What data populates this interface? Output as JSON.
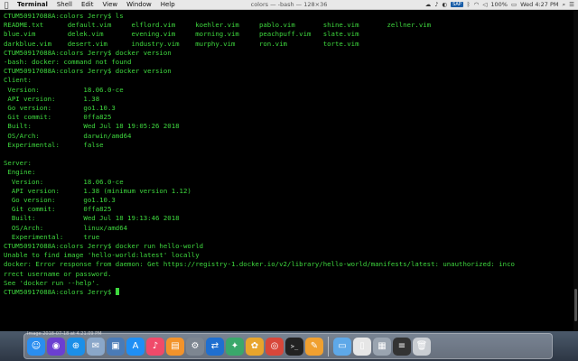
{
  "menubar": {
    "apple": "",
    "items": [
      "Terminal",
      "Shell",
      "Edit",
      "View",
      "Window",
      "Help"
    ],
    "window_title": "colors — -bash — 128×36",
    "sap": "SAP",
    "battery": "100%",
    "clock": "Wed 4:27 PM"
  },
  "terminal": {
    "lines": [
      "CTUM50917088A:colors Jerry$ ls",
      "README.txt      default.vim     elflord.vim     koehler.vim     pablo.vim       shine.vim       zellner.vim",
      "blue.vim        delek.vim       evening.vim     morning.vim     peachpuff.vim   slate.vim",
      "darkblue.vim    desert.vim      industry.vim    murphy.vim      ron.vim         torte.vim",
      "CTUM50917088A:colors Jerry$ docker version",
      "-bash: docker: command not found",
      "CTUM50917088A:colors Jerry$ docker version",
      "Client:",
      " Version:           18.06.0-ce",
      " API version:       1.38",
      " Go version:        go1.10.3",
      " Git commit:        0ffa825",
      " Built:             Wed Jul 18 19:05:26 2018",
      " OS/Arch:           darwin/amd64",
      " Experimental:      false",
      "",
      "Server:",
      " Engine:",
      "  Version:          18.06.0-ce",
      "  API version:      1.38 (minimum version 1.12)",
      "  Go version:       go1.10.3",
      "  Git commit:       0ffa825",
      "  Built:            Wed Jul 18 19:13:46 2018",
      "  OS/Arch:          linux/amd64",
      "  Experimental:     true",
      "CTUM50917088A:colors Jerry$ docker run hello-world",
      "Unable to find image 'hello-world:latest' locally",
      "docker: Error response from daemon: Get https://registry-1.docker.io/v2/library/hello-world/manifests/latest: unauthorized: inco",
      "rrect username or password.",
      "See 'docker run --help'."
    ],
    "prompt": "CTUM50917088A:colors Jerry$ "
  },
  "desktop": {
    "label": "Image 2018-07-18 at 4.21.09 PM"
  },
  "dock": {
    "icons": [
      {
        "name": "finder-icon",
        "glyph": "☺",
        "color": "#2a8ef0"
      },
      {
        "name": "siri-icon",
        "glyph": "◉",
        "color": "#6b3fd1"
      },
      {
        "name": "safari-icon",
        "glyph": "⊕",
        "color": "#1b8fe8"
      },
      {
        "name": "mail-icon",
        "glyph": "✉",
        "color": "#8aa7c9"
      },
      {
        "name": "preview-icon",
        "glyph": "▣",
        "color": "#4a7bb7"
      },
      {
        "name": "app-store-icon",
        "glyph": "A",
        "color": "#1f8ff5"
      },
      {
        "name": "music-icon",
        "glyph": "♪",
        "color": "#f04a6a"
      },
      {
        "name": "books-icon",
        "glyph": "▤",
        "color": "#f2932b"
      },
      {
        "name": "system-preferences-icon",
        "glyph": "⚙",
        "color": "#7d8691"
      },
      {
        "name": "teamviewer-icon",
        "glyph": "⇄",
        "color": "#1f6fd0"
      },
      {
        "name": "network-icon",
        "glyph": "✦",
        "color": "#3aa86b"
      },
      {
        "name": "photos-icon",
        "glyph": "✿",
        "color": "#e8a52c"
      },
      {
        "name": "chrome-icon",
        "glyph": "◎",
        "color": "#d8473a"
      },
      {
        "name": "terminal-icon",
        "glyph": ">_",
        "color": "#222222"
      },
      {
        "name": "pages-icon",
        "glyph": "✎",
        "color": "#f0a030"
      }
    ],
    "right_icons": [
      {
        "name": "folder-icon",
        "glyph": "▭",
        "color": "#5ea8e8"
      },
      {
        "name": "document-icon",
        "glyph": "▯",
        "color": "#e6e6e6"
      },
      {
        "name": "screenshot-icon",
        "glyph": "▦",
        "color": "#9aa4b0"
      },
      {
        "name": "console-icon",
        "glyph": "≡",
        "color": "#333333"
      },
      {
        "name": "trash-icon",
        "glyph": "🗑",
        "color": "#c9cdd2"
      }
    ]
  }
}
